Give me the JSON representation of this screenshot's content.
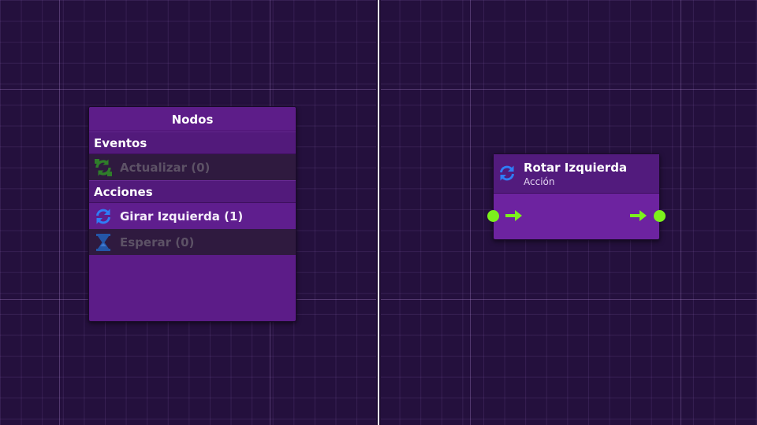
{
  "palette": {
    "title": "Nodos",
    "sections": [
      {
        "label": "Eventos",
        "items": [
          {
            "label": "Actualizar (0)",
            "icon": "refresh-cycle-icon",
            "enabled": false
          }
        ]
      },
      {
        "label": "Acciones",
        "items": [
          {
            "label": "Girar Izquierda (1)",
            "icon": "rotate-icon",
            "enabled": true
          },
          {
            "label": "Esperar (0)",
            "icon": "hourglass-icon",
            "enabled": false
          }
        ]
      }
    ]
  },
  "node": {
    "title": "Rotar Izquierda",
    "subtitle": "Acción",
    "icon": "rotate-icon",
    "input_port": "flow-in",
    "output_port": "flow-out"
  },
  "colors": {
    "background": "#24103d",
    "panel": "#5c1c88",
    "port": "#7cf11c",
    "icon_blue": "#2f7df6",
    "icon_green_disabled": "#2f7d2a"
  }
}
